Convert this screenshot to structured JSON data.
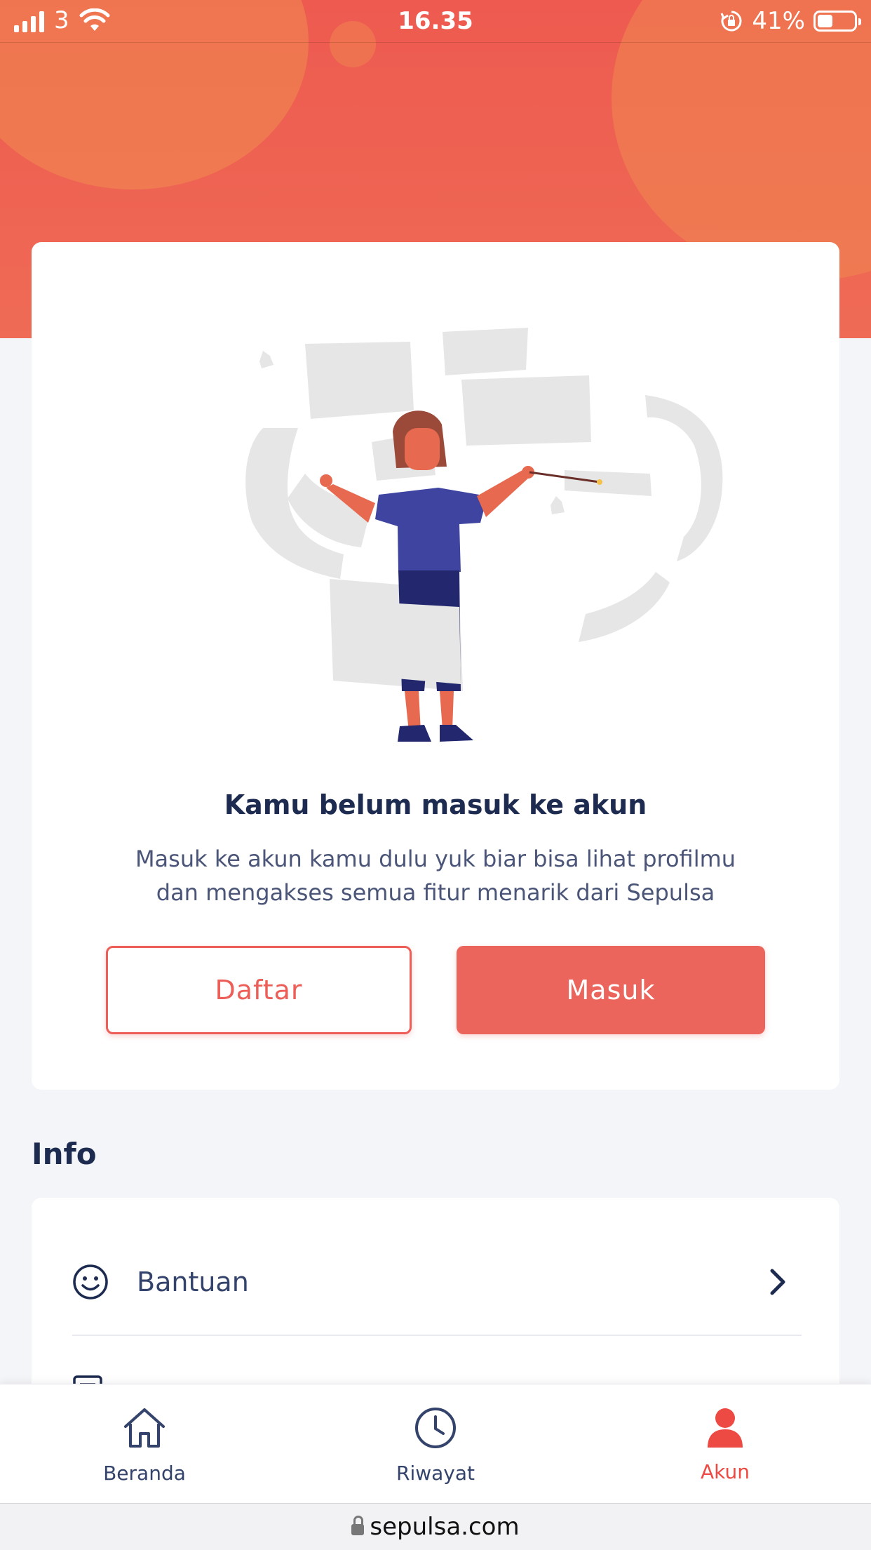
{
  "status_bar": {
    "carrier": "3",
    "time": "16.35",
    "battery_percent": "41%",
    "battery_level": 0.41
  },
  "login_card": {
    "title": "Kamu belum masuk ke akun",
    "description_line1": "Masuk ke akun kamu dulu yuk biar bisa lihat profilmu",
    "description_line2": "dan mengakses semua fitur menarik dari Sepulsa",
    "register_label": "Daftar",
    "login_label": "Masuk"
  },
  "info": {
    "title": "Info",
    "items": [
      {
        "label": "Bantuan",
        "icon": "smiley-icon"
      }
    ]
  },
  "bottom_nav": {
    "items": [
      {
        "label": "Beranda",
        "icon": "home-icon"
      },
      {
        "label": "Riwayat",
        "icon": "clock-icon"
      },
      {
        "label": "Akun",
        "icon": "user-icon",
        "active": true
      }
    ]
  },
  "browser": {
    "url": "sepulsa.com"
  },
  "colors": {
    "accent": "#ec5e57",
    "navy": "#1c2b4f",
    "background": "#f4f5f8"
  }
}
